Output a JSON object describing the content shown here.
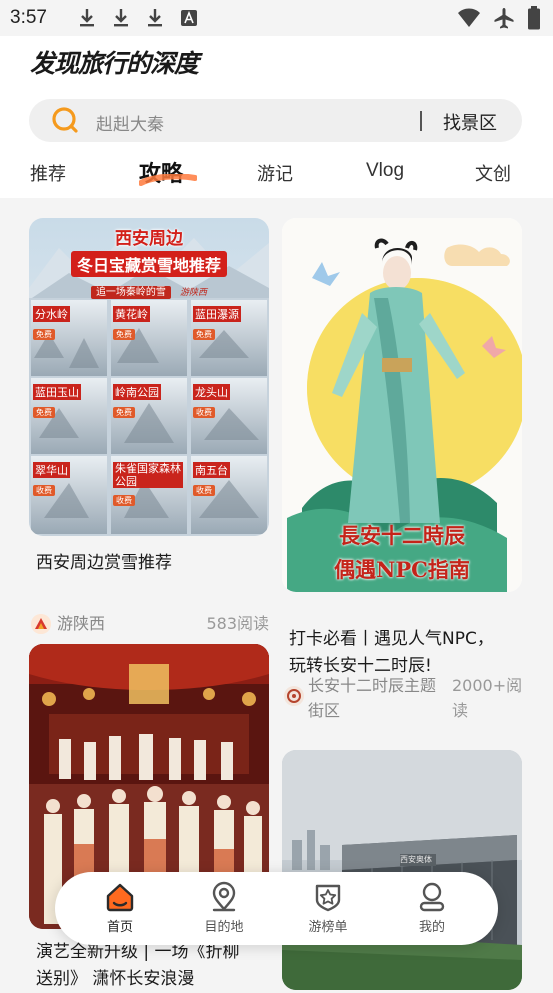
{
  "status_bar": {
    "time": "3:57"
  },
  "header": {
    "logo": "发现旅行的深度"
  },
  "search": {
    "placeholder": "赳赳大秦",
    "button": "找景区"
  },
  "tabs": [
    {
      "label": "推荐"
    },
    {
      "label": "攻略",
      "active": true
    },
    {
      "label": "游记"
    },
    {
      "label": "Vlog"
    },
    {
      "label": "文创"
    }
  ],
  "colors": {
    "accent": "#ff6a1f",
    "search_icon": "#f59a1d",
    "active_underline": "#ff7a3d"
  },
  "cards": [
    {
      "image_texts": [
        "西安周边",
        "冬日宝藏赏雪地推荐",
        "追一场秦岭的雪",
        "游陕西"
      ],
      "grid": [
        {
          "name": "分水岭",
          "tag": "免费"
        },
        {
          "name": "黄花岭",
          "tag": "免费"
        },
        {
          "name": "蓝田瀑源",
          "tag": "免费"
        },
        {
          "name": "蓝田玉山",
          "tag": "免费"
        },
        {
          "name": "岭南公园",
          "tag": "免费"
        },
        {
          "name": "龙头山",
          "tag": "收费"
        },
        {
          "name": "翠华山",
          "tag": "收费"
        },
        {
          "name": "朱雀国家森林公园",
          "tag": "收费"
        },
        {
          "name": "南五台",
          "tag": "收费"
        }
      ],
      "title": "西安周边赏雪推荐",
      "author": "游陕西",
      "reads": "583阅读"
    },
    {
      "image_texts": [
        "長安十二時辰",
        "偶遇NPC指南"
      ],
      "title_line1": "打卡必看丨遇见人气NPC，",
      "title_line2": "玩转长安十二时辰!",
      "author_line1": "长安十二时辰主题",
      "author_line2": "街区",
      "reads_line1": "2000+阅",
      "reads_line2": "读"
    },
    {
      "title_line1": "演艺全新升级 | 一场《折柳",
      "title_line2": "送别》 潇怀长安浪漫"
    },
    {
      "image_texts": [
        "西安奥体"
      ]
    }
  ],
  "navbar": [
    {
      "label": "首页",
      "icon": "home-icon",
      "active": true
    },
    {
      "label": "目的地",
      "icon": "location-pin-icon"
    },
    {
      "label": "游榜单",
      "icon": "star-shield-icon"
    },
    {
      "label": "我的",
      "icon": "profile-icon"
    }
  ]
}
